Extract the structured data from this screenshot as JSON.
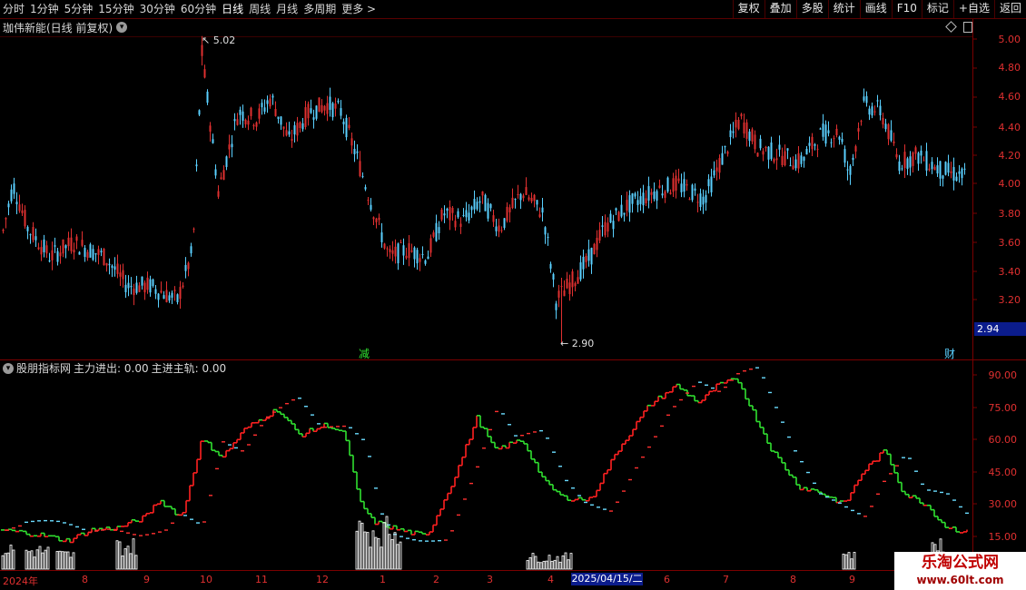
{
  "toolbar": {
    "periods": [
      "分时",
      "1分钟",
      "5分钟",
      "15分钟",
      "30分钟",
      "60分钟",
      "日线",
      "周线",
      "月线",
      "多周期",
      "更多 >"
    ],
    "tools": [
      "复权",
      "叠加",
      "多股",
      "统计",
      "画线",
      "F10",
      "标记",
      "+自选",
      "返回"
    ]
  },
  "main_chart": {
    "title": "珈伟新能(日线 前复权)",
    "y_labels": [
      "5.00",
      "4.80",
      "4.60",
      "4.40",
      "4.20",
      "4.00",
      "3.80",
      "3.60",
      "3.40",
      "3.20"
    ],
    "high_label": "5.02",
    "low_label": "2.90",
    "current_price": "2.94",
    "marker_jian": "减",
    "marker_cai": "财"
  },
  "indicator": {
    "name": "股朋指标网",
    "line1": "主力进出: 0.00",
    "line2": "主进主轨: 0.00",
    "y_labels": [
      "90.00",
      "75.00",
      "60.00",
      "45.00",
      "30.00",
      "15.00"
    ]
  },
  "x_axis": {
    "labels": [
      "2024年",
      "8",
      "9",
      "10",
      "11",
      "12",
      "1",
      "2",
      "3",
      "4",
      "6",
      "7",
      "8",
      "9"
    ],
    "cursor_date": "2025/04/15/二"
  },
  "watermark": {
    "line1": "乐淘公式网",
    "line2": "www.60lt.com"
  },
  "colors": {
    "up": "#e03030",
    "down": "#5ad0ff",
    "line_up": "#ff2020",
    "line_down": "#30e030",
    "axis": "#7a0000"
  }
}
